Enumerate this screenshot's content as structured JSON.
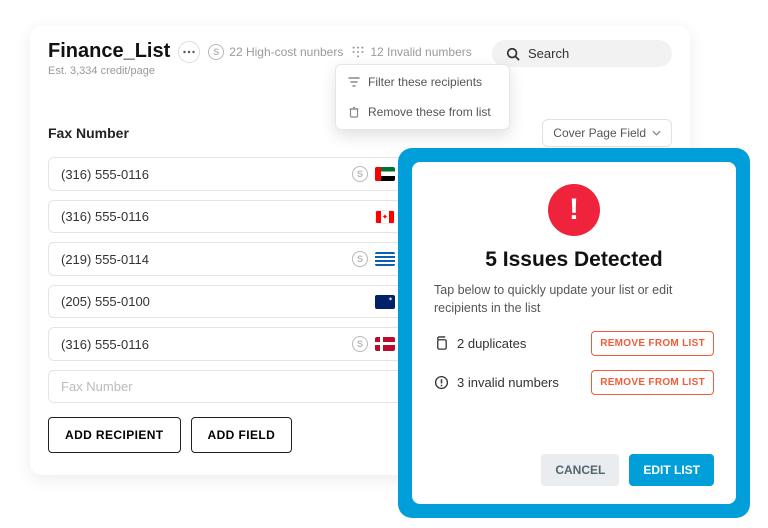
{
  "header": {
    "title": "Finance_List",
    "subtitle": "Est. 3,334 credit/page",
    "highcost_label": "22 High-cost nunbers",
    "invalid_label": "12 Invalid numbers",
    "search_placeholder": "Search"
  },
  "dropdown": {
    "filter": "Filter these recipients",
    "remove": "Remove these from list"
  },
  "columns": {
    "fax": "Fax Number",
    "cover": "Cover Page Field"
  },
  "rows": [
    {
      "number": "(316) 555-0116",
      "highcost": true,
      "flag": "ae"
    },
    {
      "number": "(316) 555-0116",
      "highcost": false,
      "flag": "ca"
    },
    {
      "number": "(219) 555-0114",
      "highcost": true,
      "flag": "gr"
    },
    {
      "number": "(205) 555-0100",
      "highcost": false,
      "flag": "au"
    },
    {
      "number": "(316) 555-0116",
      "highcost": true,
      "flag": "no"
    }
  ],
  "placeholder_row": "Fax Number",
  "buttons": {
    "add_recipient": "ADD RECIPIENT",
    "add_field": "ADD FIELD"
  },
  "modal": {
    "title": "5 Issues Detected",
    "desc": "Tap below to quickly update your list or edit recipients in the list",
    "duplicates": "2 duplicates",
    "invalid": "3 invalid numbers",
    "remove": "REMOVE FROM LIST",
    "cancel": "CANCEL",
    "edit": "EDIT LIST"
  }
}
